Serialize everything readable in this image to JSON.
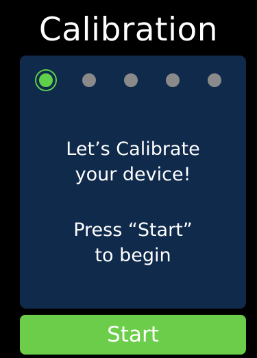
{
  "header": {
    "title": "Calibration"
  },
  "steps": {
    "count": 5,
    "current": 1,
    "active_color": "#5fd04a",
    "inactive_color": "#8a8a8a"
  },
  "panel": {
    "background_color": "#102a4c",
    "message_line1": "Let’s Calibrate",
    "message_line2": "your device!",
    "instruction_line1": "Press “Start”",
    "instruction_line2": "to begin"
  },
  "actions": {
    "start_label": "Start",
    "start_color": "#6ccd4a"
  }
}
